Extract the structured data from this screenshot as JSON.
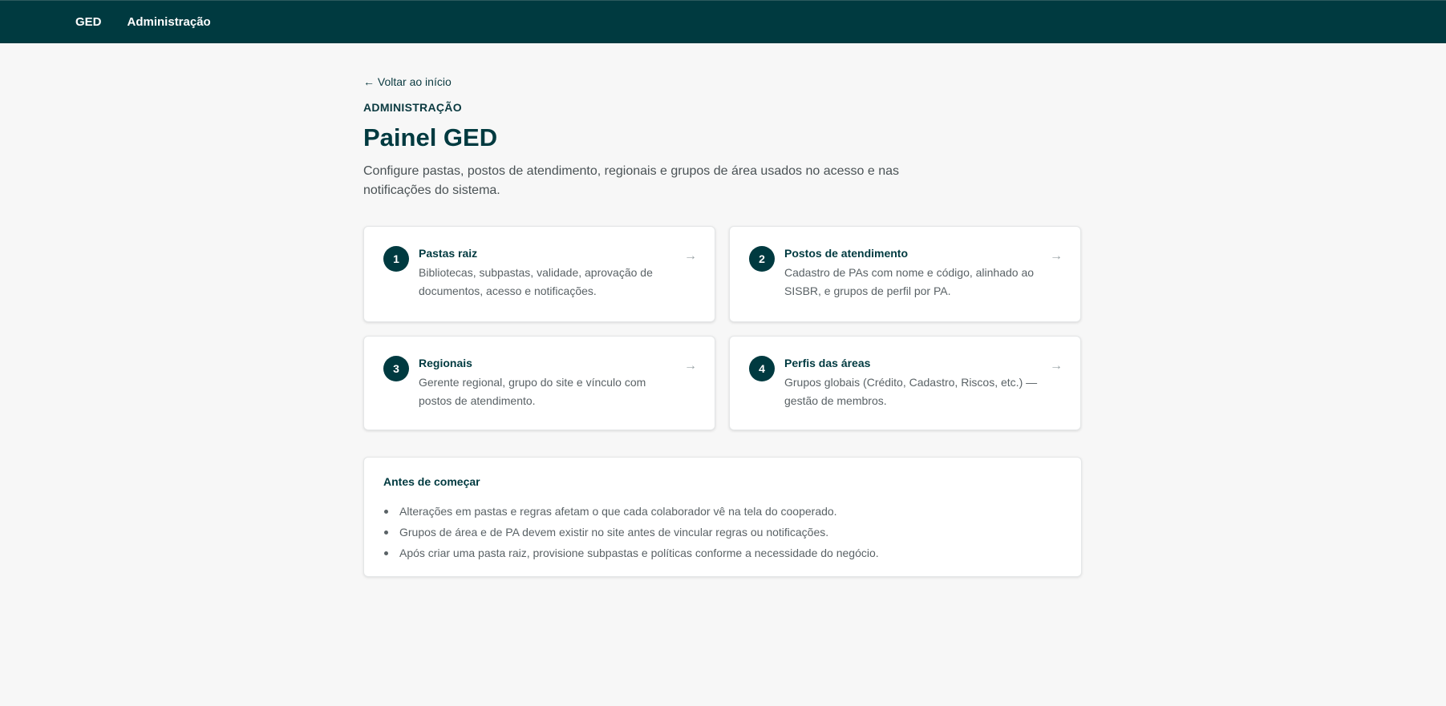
{
  "topbar": {
    "brand": "GED",
    "nav_admin": "Administração"
  },
  "main": {
    "back_link": "← Voltar ao início",
    "eyebrow": "ADMINISTRAÇÃO",
    "title": "Painel GED",
    "description": "Configure pastas, postos de atendimento, regionais e grupos de área usados no acesso e nas notificações do sistema."
  },
  "cards": [
    {
      "number": "1",
      "title": "Pastas raiz",
      "description": "Bibliotecas, subpastas, validade, aprovação de documentos, acesso e notificações.",
      "arrow": "→"
    },
    {
      "number": "2",
      "title": "Postos de atendimento",
      "description": "Cadastro de PAs com nome e código, alinhado ao SISBR, e grupos de perfil por PA.",
      "arrow": "→"
    },
    {
      "number": "3",
      "title": "Regionais",
      "description": "Gerente regional, grupo do site e vínculo com postos de atendimento.",
      "arrow": "→"
    },
    {
      "number": "4",
      "title": "Perfis das áreas",
      "description": "Grupos globais (Crédito, Cadastro, Riscos, etc.) — gestão de membros.",
      "arrow": "→"
    }
  ],
  "info": {
    "title": "Antes de começar",
    "items": [
      "Alterações em pastas e regras afetam o que cada colaborador vê na tela do cooperado.",
      "Grupos de área e de PA devem existir no site antes de vincular regras ou notificações.",
      "Após criar uma pasta raiz, provisione subpastas e políticas conforme a necessidade do negócio."
    ]
  },
  "colors": {
    "topbar": "#003a40",
    "accent": "#003a40",
    "background": "#f7f7f7"
  }
}
